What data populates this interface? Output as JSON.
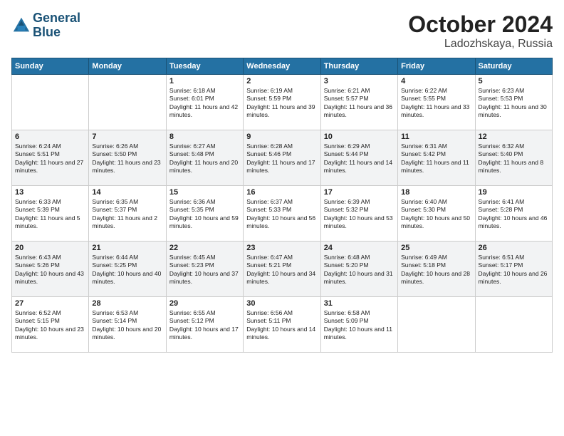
{
  "header": {
    "logo_line1": "General",
    "logo_line2": "Blue",
    "title": "October 2024",
    "location": "Ladozhskaya, Russia"
  },
  "weekdays": [
    "Sunday",
    "Monday",
    "Tuesday",
    "Wednesday",
    "Thursday",
    "Friday",
    "Saturday"
  ],
  "weeks": [
    [
      {
        "day": "",
        "info": ""
      },
      {
        "day": "",
        "info": ""
      },
      {
        "day": "1",
        "info": "Sunrise: 6:18 AM\nSunset: 6:01 PM\nDaylight: 11 hours and 42 minutes."
      },
      {
        "day": "2",
        "info": "Sunrise: 6:19 AM\nSunset: 5:59 PM\nDaylight: 11 hours and 39 minutes."
      },
      {
        "day": "3",
        "info": "Sunrise: 6:21 AM\nSunset: 5:57 PM\nDaylight: 11 hours and 36 minutes."
      },
      {
        "day": "4",
        "info": "Sunrise: 6:22 AM\nSunset: 5:55 PM\nDaylight: 11 hours and 33 minutes."
      },
      {
        "day": "5",
        "info": "Sunrise: 6:23 AM\nSunset: 5:53 PM\nDaylight: 11 hours and 30 minutes."
      }
    ],
    [
      {
        "day": "6",
        "info": "Sunrise: 6:24 AM\nSunset: 5:51 PM\nDaylight: 11 hours and 27 minutes."
      },
      {
        "day": "7",
        "info": "Sunrise: 6:26 AM\nSunset: 5:50 PM\nDaylight: 11 hours and 23 minutes."
      },
      {
        "day": "8",
        "info": "Sunrise: 6:27 AM\nSunset: 5:48 PM\nDaylight: 11 hours and 20 minutes."
      },
      {
        "day": "9",
        "info": "Sunrise: 6:28 AM\nSunset: 5:46 PM\nDaylight: 11 hours and 17 minutes."
      },
      {
        "day": "10",
        "info": "Sunrise: 6:29 AM\nSunset: 5:44 PM\nDaylight: 11 hours and 14 minutes."
      },
      {
        "day": "11",
        "info": "Sunrise: 6:31 AM\nSunset: 5:42 PM\nDaylight: 11 hours and 11 minutes."
      },
      {
        "day": "12",
        "info": "Sunrise: 6:32 AM\nSunset: 5:40 PM\nDaylight: 11 hours and 8 minutes."
      }
    ],
    [
      {
        "day": "13",
        "info": "Sunrise: 6:33 AM\nSunset: 5:39 PM\nDaylight: 11 hours and 5 minutes."
      },
      {
        "day": "14",
        "info": "Sunrise: 6:35 AM\nSunset: 5:37 PM\nDaylight: 11 hours and 2 minutes."
      },
      {
        "day": "15",
        "info": "Sunrise: 6:36 AM\nSunset: 5:35 PM\nDaylight: 10 hours and 59 minutes."
      },
      {
        "day": "16",
        "info": "Sunrise: 6:37 AM\nSunset: 5:33 PM\nDaylight: 10 hours and 56 minutes."
      },
      {
        "day": "17",
        "info": "Sunrise: 6:39 AM\nSunset: 5:32 PM\nDaylight: 10 hours and 53 minutes."
      },
      {
        "day": "18",
        "info": "Sunrise: 6:40 AM\nSunset: 5:30 PM\nDaylight: 10 hours and 50 minutes."
      },
      {
        "day": "19",
        "info": "Sunrise: 6:41 AM\nSunset: 5:28 PM\nDaylight: 10 hours and 46 minutes."
      }
    ],
    [
      {
        "day": "20",
        "info": "Sunrise: 6:43 AM\nSunset: 5:26 PM\nDaylight: 10 hours and 43 minutes."
      },
      {
        "day": "21",
        "info": "Sunrise: 6:44 AM\nSunset: 5:25 PM\nDaylight: 10 hours and 40 minutes."
      },
      {
        "day": "22",
        "info": "Sunrise: 6:45 AM\nSunset: 5:23 PM\nDaylight: 10 hours and 37 minutes."
      },
      {
        "day": "23",
        "info": "Sunrise: 6:47 AM\nSunset: 5:21 PM\nDaylight: 10 hours and 34 minutes."
      },
      {
        "day": "24",
        "info": "Sunrise: 6:48 AM\nSunset: 5:20 PM\nDaylight: 10 hours and 31 minutes."
      },
      {
        "day": "25",
        "info": "Sunrise: 6:49 AM\nSunset: 5:18 PM\nDaylight: 10 hours and 28 minutes."
      },
      {
        "day": "26",
        "info": "Sunrise: 6:51 AM\nSunset: 5:17 PM\nDaylight: 10 hours and 26 minutes."
      }
    ],
    [
      {
        "day": "27",
        "info": "Sunrise: 6:52 AM\nSunset: 5:15 PM\nDaylight: 10 hours and 23 minutes."
      },
      {
        "day": "28",
        "info": "Sunrise: 6:53 AM\nSunset: 5:14 PM\nDaylight: 10 hours and 20 minutes."
      },
      {
        "day": "29",
        "info": "Sunrise: 6:55 AM\nSunset: 5:12 PM\nDaylight: 10 hours and 17 minutes."
      },
      {
        "day": "30",
        "info": "Sunrise: 6:56 AM\nSunset: 5:11 PM\nDaylight: 10 hours and 14 minutes."
      },
      {
        "day": "31",
        "info": "Sunrise: 6:58 AM\nSunset: 5:09 PM\nDaylight: 10 hours and 11 minutes."
      },
      {
        "day": "",
        "info": ""
      },
      {
        "day": "",
        "info": ""
      }
    ]
  ]
}
